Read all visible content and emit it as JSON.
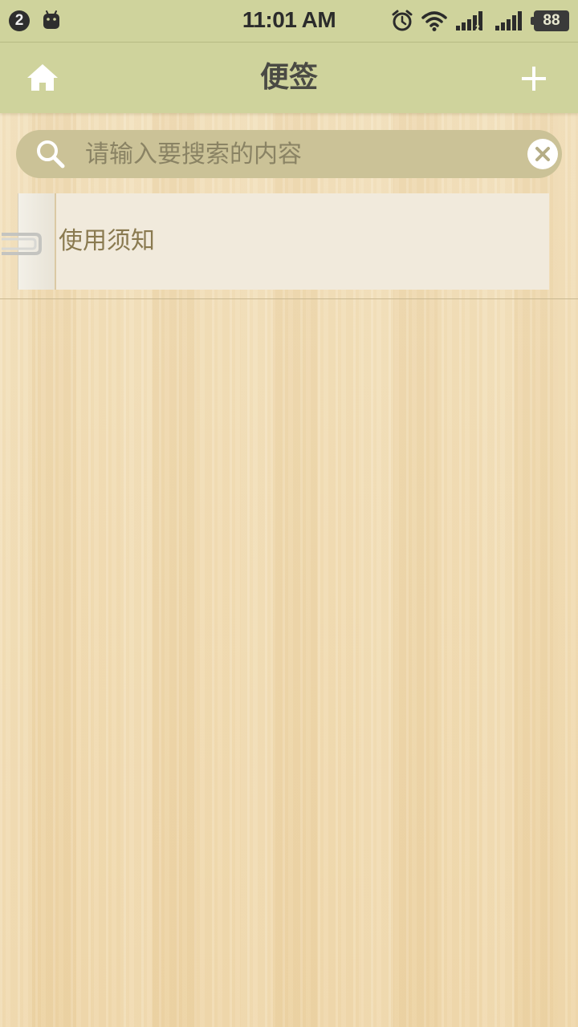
{
  "status_bar": {
    "notification_count": "2",
    "time": "11:01 AM",
    "battery": "88",
    "signal_sim2_label": "2",
    "icons": [
      "android-icon",
      "alarm-icon",
      "wifi-icon",
      "signal-icon",
      "signal-icon",
      "battery-icon"
    ]
  },
  "title_bar": {
    "title": "便签",
    "left_icon": "home-icon",
    "right_icon": "plus-icon"
  },
  "search": {
    "placeholder": "请输入要搜索的内容",
    "value": "",
    "icon": "search-icon",
    "clear_icon": "clear-icon"
  },
  "notes": [
    {
      "title": "使用须知"
    }
  ],
  "colors": {
    "bar": "#cfd39c",
    "search_bg": "#cbc297",
    "note_bg": "#f1eadc",
    "note_text": "#8a7a50",
    "wood": "#f2dfb7"
  }
}
